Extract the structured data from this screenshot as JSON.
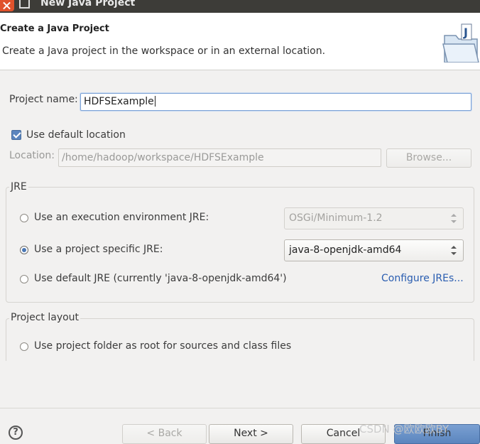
{
  "window": {
    "title": "New Java Project",
    "close_icon": "close-icon",
    "maximize_icon": "maximize-icon"
  },
  "banner": {
    "title": "Create a Java Project",
    "description": "Create a Java project in the workspace or in an external location.",
    "icon": "project-wizard-icon"
  },
  "project_name": {
    "label": "Project name:",
    "value": "HDFSExample"
  },
  "location": {
    "use_default_label": "Use default location",
    "use_default_checked": true,
    "label": "Location:",
    "value": "/home/hadoop/workspace/HDFSExample",
    "browse_label": "Browse..."
  },
  "jre": {
    "group_title": "JRE",
    "options": [
      {
        "label": "Use an execution environment JRE:",
        "selected": false
      },
      {
        "label": "Use a project specific JRE:",
        "selected": true
      },
      {
        "label": "Use default JRE (currently 'java-8-openjdk-amd64')",
        "selected": false
      }
    ],
    "execution_env_value": "OSGi/Minimum-1.2",
    "project_jre_value": "java-8-openjdk-amd64",
    "configure_link": "Configure JREs..."
  },
  "layout": {
    "group_title": "Project layout",
    "option_label": "Use project folder as root for sources and class files"
  },
  "footer": {
    "back_label": "< Back",
    "next_label": "Next >",
    "cancel_label": "Cancel",
    "finish_label": "Finish",
    "watermark": "CSDN @欧欧欧BY"
  },
  "colors": {
    "accent": "#5b85be",
    "link": "#2a5db0",
    "titlebar": "#3d3c38",
    "close": "#e0522c"
  }
}
